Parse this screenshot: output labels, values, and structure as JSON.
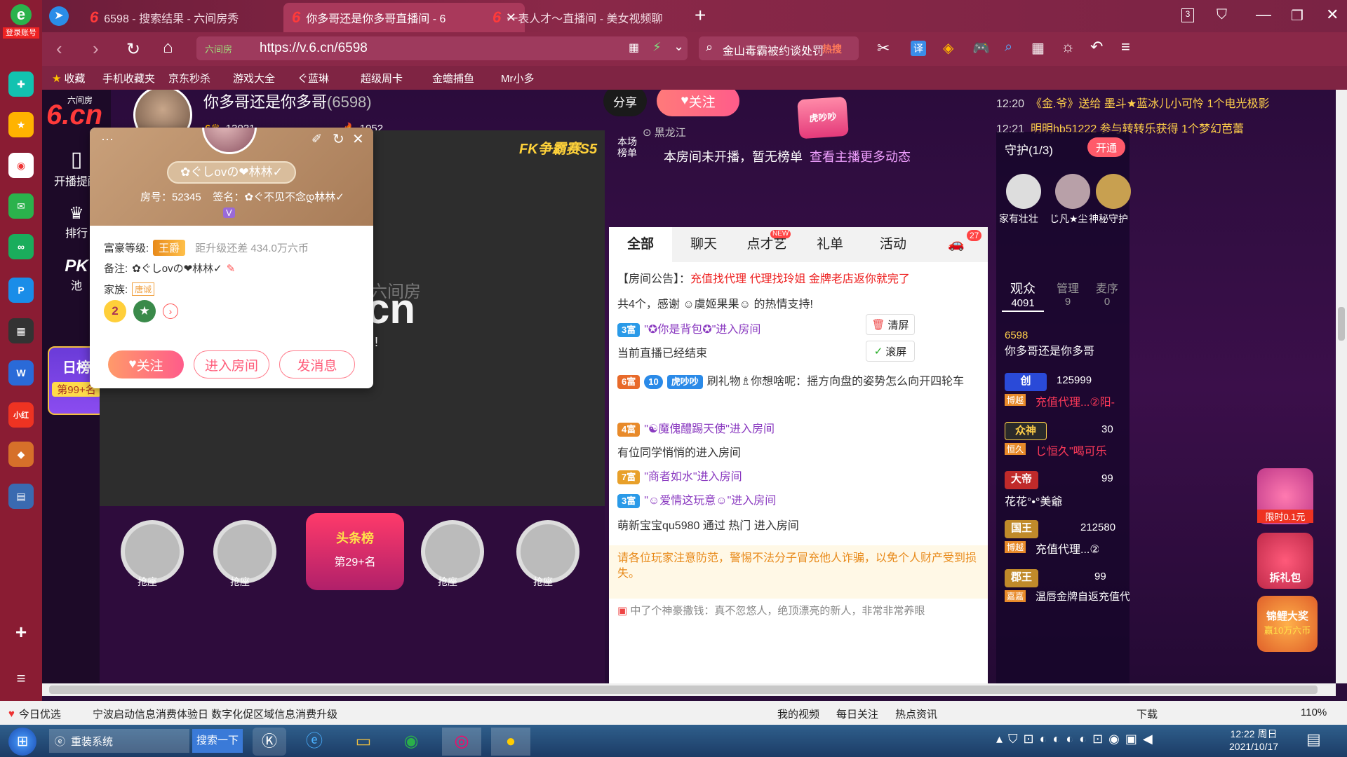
{
  "browser": {
    "tabs": [
      {
        "label": "6598 - 搜索结果 - 六间房秀"
      },
      {
        "label": "你多哥还是你多哥直播间 - 6"
      },
      {
        "label": "一表人才～直播间 - 美女视频聊"
      }
    ],
    "new_tab": "+",
    "tab_count": "3",
    "url": "https://v.6.cn/6598",
    "url_prefix": "六间房",
    "search_placeholder": "金山毒霸被约谈处罚",
    "search_hot": "热搜",
    "translate": "译",
    "login_label": "登录账号",
    "bookmarks": [
      "收藏",
      "手机收藏夹",
      "京东秒杀",
      "游戏大全",
      "ぐ蓝琳",
      "超级周卡",
      "金蟾捕鱼",
      "Mr小多"
    ]
  },
  "site": {
    "logo_small": "六间房",
    "logo": "6.cn",
    "nav": [
      {
        "label": "开播提醒"
      },
      {
        "label": "排行"
      },
      {
        "label": "池"
      }
    ],
    "pk_label": "PK",
    "daily_rank": "日榜",
    "daily_rank_num": "第99+名"
  },
  "streamer": {
    "name": "你多哥还是你多哥",
    "room_id": "(6598)",
    "fans": "13031",
    "heat": "1052",
    "location": "黑龙江",
    "share": "分享",
    "follow": "关注",
    "badge": "虎吵吵"
  },
  "gifts_feed": [
    {
      "time": "12:20",
      "text": "《金.爷》送给 墨斗★蓝冰儿小可怜 1个电光极影"
    },
    {
      "time": "12:21",
      "text": "明明hb51222 参与转转乐获得 1个梦幻芭蕾"
    }
  ],
  "ranking": {
    "label_a": "本场",
    "label_b": "榜单",
    "text": "本房间未开播，暂无榜单",
    "link": "查看主播更多动态"
  },
  "chat_tabs": [
    "全部",
    "聊天",
    "点才艺",
    "礼单",
    "活动"
  ],
  "chat_tab_new": "NEW",
  "chat_car_count": "27",
  "announcement": {
    "prefix": "【房间公告】：",
    "text": "充值找代理 代理找玲姐 金牌老店返你就完了"
  },
  "chat": [
    "共4个，感谢 ☺虞姬果果☺ 的热情支持!",
    "\"✪你是背包✪\"进入房间",
    "当前直播已经结束",
    "刷礼物♗你想啥呢：摇方向盘的姿势怎么向开四轮车",
    "\"☯魔傀醴踢天使\"进入房间",
    "有位同学悄悄的进入房间",
    "\"商者如水\"进入房间",
    "\"☺爱情这玩意☺\"进入房间",
    "萌新宝宝qu5980 通过 热门 进入房间"
  ],
  "chat_badges": [
    "3富",
    "6富",
    "4富",
    "7富",
    "3富"
  ],
  "chat_level": "10",
  "chat_tag": "虎吵吵",
  "chat_clear": "清屏",
  "chat_scroll": "滚屏",
  "warning": "请各位玩家注意防范，警惕不法分子冒充他人诈骗，以免个人财产受到损失。",
  "bottom_chat": "中了个神豪撒钱：真不忽悠人，绝顶漂亮的新人，非常非常养眼",
  "guard": {
    "title": "守护(1/3)",
    "open": "开通",
    "members": [
      "家有壮壮",
      "じ凡★尘",
      "神秘守护"
    ]
  },
  "audience": {
    "tabs": [
      {
        "label": "观众",
        "count": "4091"
      },
      {
        "label": "管理",
        "count": "9"
      },
      {
        "label": "麦序",
        "count": "0"
      }
    ],
    "list": [
      {
        "id": "6598",
        "name": "你多哥还是你多哥"
      },
      {
        "id": "125999",
        "name": "充值代理...②阳-"
      },
      {
        "id": "30",
        "name": "じ恒久\"喝可乐"
      },
      {
        "id": "99",
        "name": "花花°•°美爺"
      },
      {
        "id": "212580",
        "name": "充值代理...②"
      },
      {
        "id": "99",
        "name": "温唇金牌自返充值代理"
      }
    ],
    "badges": [
      "创",
      "众神",
      "大帝",
      "国王",
      "郡王"
    ],
    "sub_badges": [
      "博越",
      "恒久",
      "博越",
      "嘉嘉"
    ]
  },
  "promo": {
    "a": "限时0.1元",
    "b": "拆礼包",
    "c": "锦鲤大奖",
    "d": "赢10万六币"
  },
  "popup": {
    "name": "✿ぐしovの❤林林✓",
    "room": "房号：52345",
    "sign": "签名：✿ぐ不见不念დ林林✓",
    "v": "V",
    "wealth_label": "富豪等级:",
    "wealth_badge": "王爵",
    "wealth_next": "距升级还差 434.0万六币",
    "note_label": "备注:",
    "note": "✿ぐしovの❤林林✓",
    "family_label": "家族:",
    "family": "唐诚",
    "medal_num": "2",
    "follow": "关注",
    "enter": "进入房间",
    "message": "发消息"
  },
  "video": {
    "fk": "FK争霸赛S5",
    "logo_small": "六间房",
    "logo": "cn",
    "end_mark": "!"
  },
  "seats": {
    "grab": "抢座",
    "headline": "头条榜",
    "headline_rank": "第29+名"
  },
  "status": {
    "left": "今日优选",
    "news": "宁波启动信息消费体验日 数字化促区域信息消费升级",
    "items": [
      "我的视频",
      "每日关注",
      "热点资讯"
    ],
    "download": "下载",
    "zoom": "110%"
  },
  "taskbar": {
    "start": "⊞",
    "app": "重装系统",
    "search": "搜索一下",
    "time": "12:22 周日",
    "date": "2021/10/17"
  }
}
